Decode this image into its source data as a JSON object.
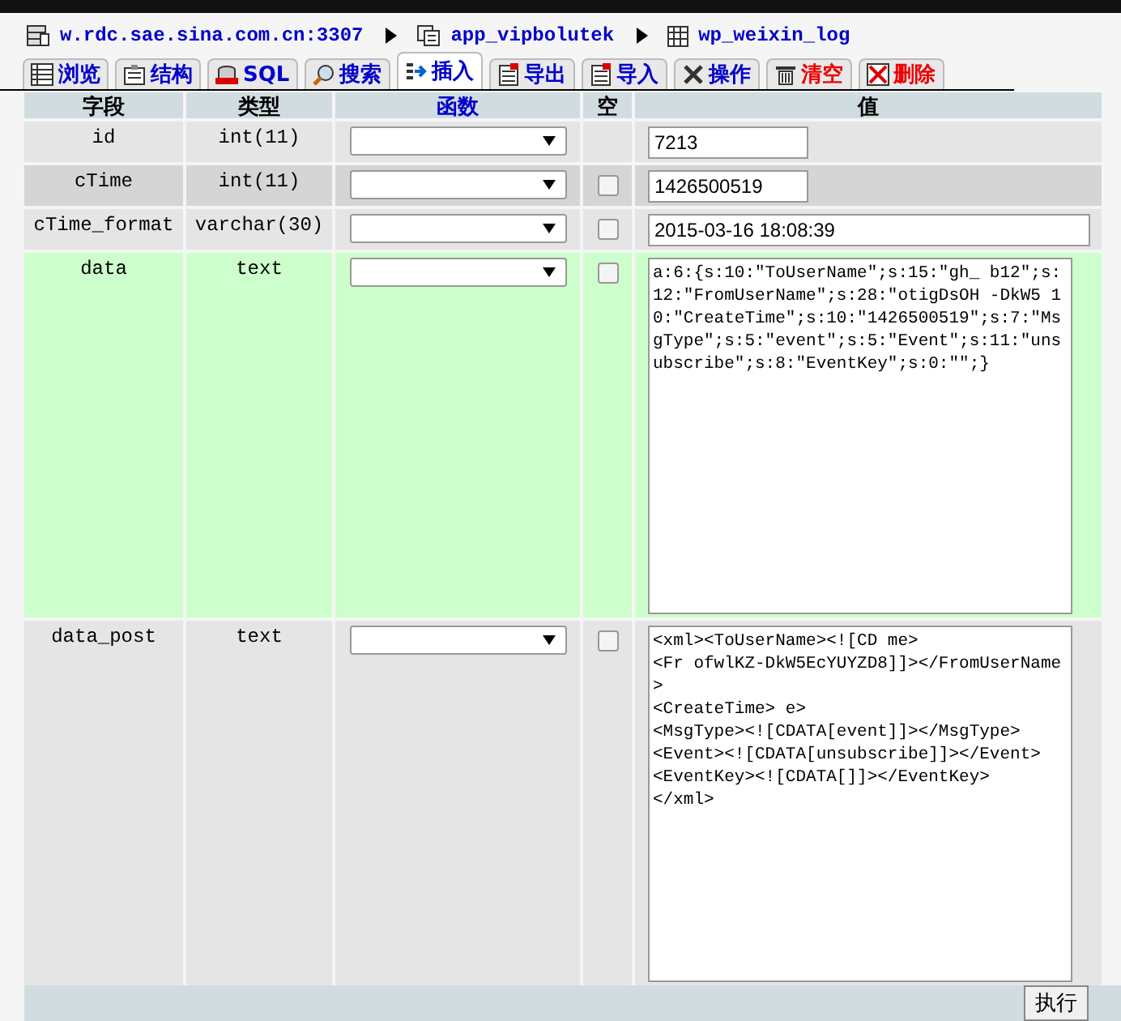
{
  "breadcrumb": [
    {
      "label": "w.rdc.sae.sina.com.cn:3307"
    },
    {
      "label": "app_vipbolutek"
    },
    {
      "label": "wp_weixin_log"
    }
  ],
  "tabs": [
    {
      "label": "浏览",
      "selected": false,
      "danger": false
    },
    {
      "label": "结构",
      "selected": false,
      "danger": false
    },
    {
      "label": "SQL",
      "selected": false,
      "danger": false
    },
    {
      "label": "搜索",
      "selected": false,
      "danger": false
    },
    {
      "label": "插入",
      "selected": true,
      "danger": false
    },
    {
      "label": "导出",
      "selected": false,
      "danger": false
    },
    {
      "label": "导入",
      "selected": false,
      "danger": false
    },
    {
      "label": "操作",
      "selected": false,
      "danger": false
    },
    {
      "label": "清空",
      "selected": false,
      "danger": true
    },
    {
      "label": "删除",
      "selected": false,
      "danger": true
    }
  ],
  "columns": [
    {
      "label": "字段",
      "link": false
    },
    {
      "label": "类型",
      "link": false
    },
    {
      "label": "函数",
      "link": true
    },
    {
      "label": "空",
      "link": false
    },
    {
      "label": "值",
      "link": false
    }
  ],
  "rows": [
    {
      "field": "id",
      "type": "int(11)",
      "marked": false,
      "kind": "short",
      "value": "7213"
    },
    {
      "field": "cTime",
      "type": "int(11)",
      "marked": false,
      "null": {
        "checked": false
      },
      "kind": "short",
      "value": "1426500519"
    },
    {
      "field": "cTime_format",
      "type": "varchar(30)",
      "marked": false,
      "null": {
        "checked": false
      },
      "kind": "long",
      "value": "2015-03-16 18:08:39"
    },
    {
      "field": "data",
      "type": "text",
      "marked": true,
      "null": {
        "checked": false
      },
      "kind": "textarea",
      "value": "a:6:{s:10:\"ToUserName\";s:15:\"gh_ b12\";s:12:\"FromUserName\";s:28:\"otigDsOH -DkW5 10:\"CreateTime\";s:10:\"1426500519\";s:7:\"MsgType\";s:5:\"event\";s:5:\"Event\";s:11:\"unsubscribe\";s:8:\"EventKey\";s:0:\"\";}"
    },
    {
      "field": "data_post",
      "type": "text",
      "marked": false,
      "null": {
        "checked": false
      },
      "kind": "textarea",
      "value": "<xml><ToUserName><![CD me>\n<Fr ofwlKZ-DkW5EcYUYZD8]]></FromUserName>\n<CreateTime> e>\n<MsgType><![CDATA[event]]></MsgType>\n<Event><![CDATA[unsubscribe]]></Event>\n<EventKey><![CDATA[]]></EventKey>\n</xml>"
    }
  ],
  "submit": "执行"
}
